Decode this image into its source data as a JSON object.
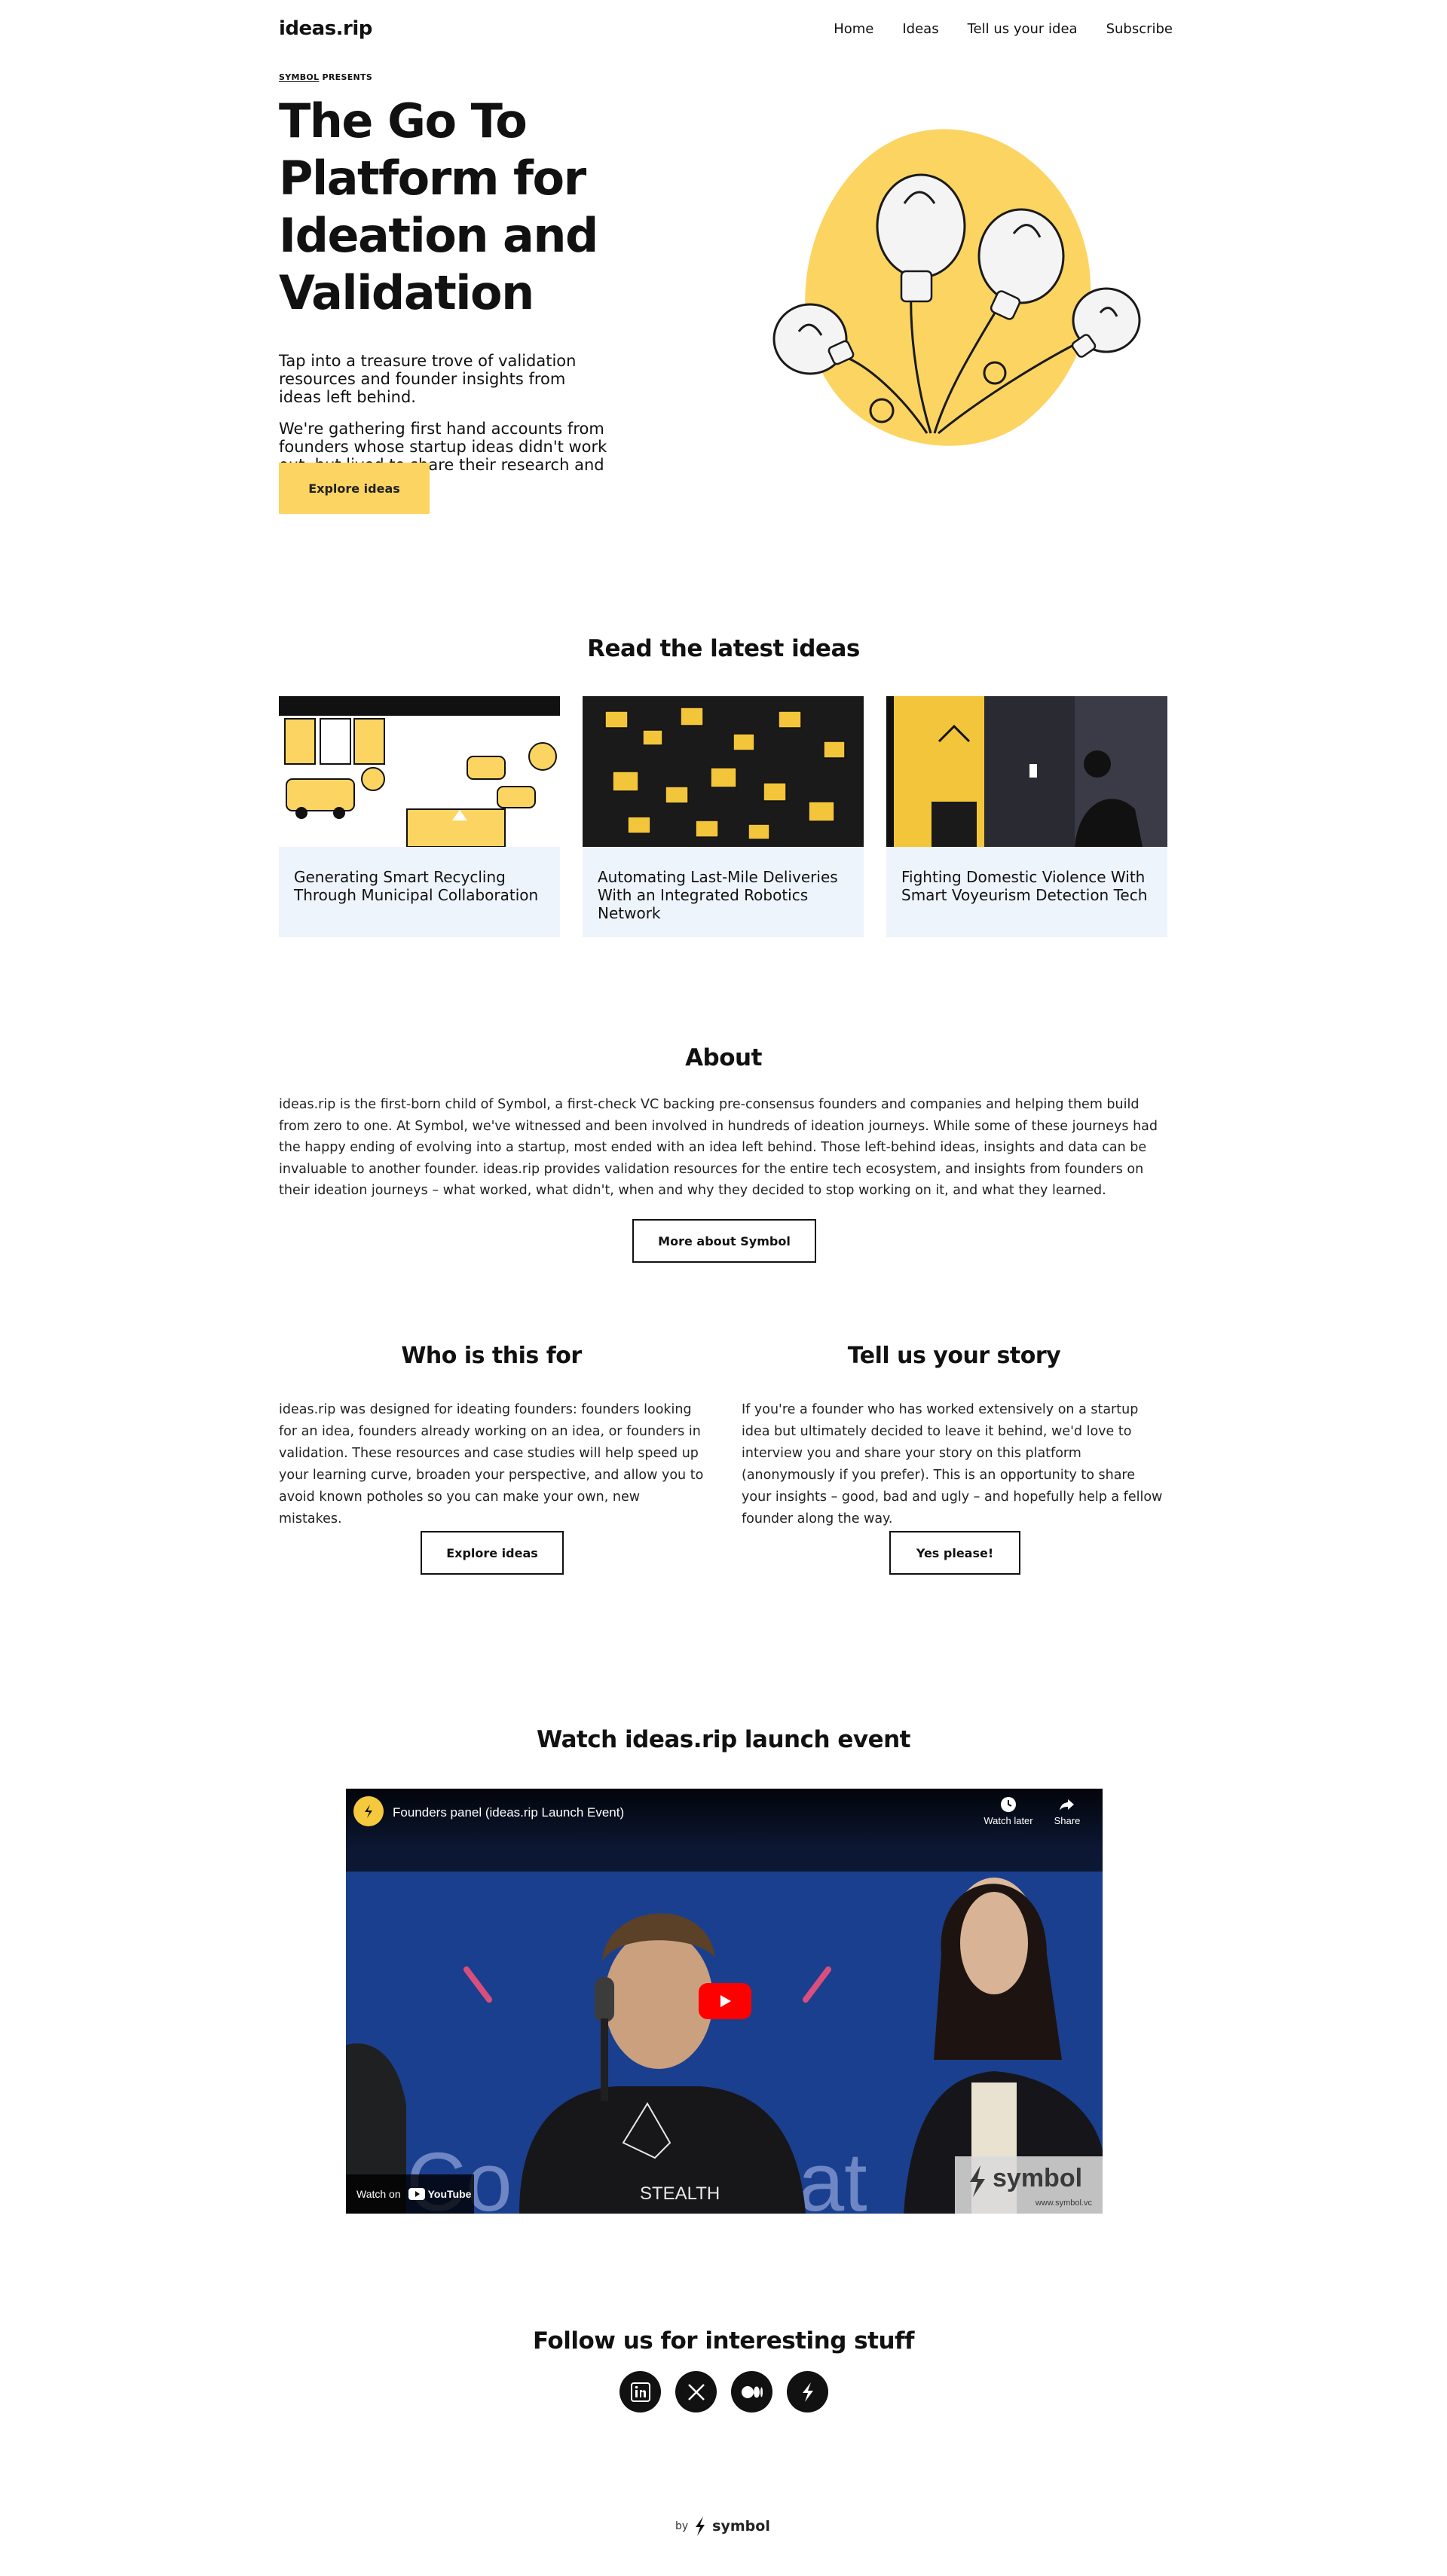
{
  "header": {
    "logo": "ideas.rip",
    "nav": [
      "Home",
      "Ideas",
      "Tell us your idea",
      "Subscribe"
    ]
  },
  "hero": {
    "presents_brand": "SYMBOL",
    "presents_text": " PRESENTS",
    "title": "The Go To Platform for Ideation and Validation",
    "paragraph1": "Tap into a treasure trove of validation resources and founder insights from ideas left behind.",
    "paragraph2": "We're gathering first hand accounts from founders whose startup ideas didn't work out, but lived to share their research and lessons learned.",
    "cta": "Explore ideas"
  },
  "latest": {
    "heading": "Read the latest ideas",
    "cards": [
      {
        "title": "Generating Smart Recycling Through Municipal Collaboration"
      },
      {
        "title": "Automating Last-Mile Deliveries With an Integrated Robotics Network"
      },
      {
        "title": "Fighting Domestic Violence With Smart Voyeurism Detection Tech"
      }
    ]
  },
  "about": {
    "heading": "About",
    "text": "ideas.rip is the first-born child of Symbol, a first-check VC backing pre-consensus founders and companies and helping them build from zero to one. At Symbol, we've witnessed and been involved in hundreds of ideation journeys. While some of these journeys had the happy ending of evolving into a startup, most ended with an idea left behind. Those left-behind ideas, insights and data can be invaluable to another founder. ideas.rip provides validation resources for the entire tech ecosystem, and insights from founders on their ideation journeys – what worked, what didn't, when and why they decided to stop working on it, and what they learned.",
    "button": "More about Symbol"
  },
  "who": {
    "heading": "Who is this for",
    "text": "ideas.rip was designed for ideating founders: founders looking for an idea, founders already working on an idea, or founders in validation. These resources and case studies will help speed up your learning curve, broaden your perspective, and allow you to avoid known potholes so you can make your own, new mistakes.",
    "button": "Explore ideas"
  },
  "story": {
    "heading": "Tell us your story",
    "text": "If you're a founder who has worked extensively on a startup idea but ultimately decided to leave it behind, we'd love to interview you and share your story on this platform (anonymously if you prefer). This is an opportunity to share your insights – good, bad and ugly – and hopefully help a fellow founder along the way.",
    "button": "Yes please!"
  },
  "video": {
    "heading": "Watch ideas.rip launch event",
    "title": "Founders panel (ideas.rip Launch Event)",
    "watch_later": "Watch later",
    "share": "Share",
    "watch_on": "Watch on",
    "youtube": "YouTube",
    "watermark_brand": "symbol",
    "watermark_url": "www.symbol.vc",
    "shirt_text": "STEALTH"
  },
  "follow": {
    "heading": "Follow us for interesting stuff",
    "icons": [
      "linkedin-icon",
      "x-icon",
      "medium-icon",
      "symbol-icon"
    ]
  },
  "footer": {
    "by": "by",
    "brand": "symbol"
  },
  "colors": {
    "accent_yellow": "#fcd461",
    "card_bg": "#eef4fb",
    "text": "#111111"
  }
}
